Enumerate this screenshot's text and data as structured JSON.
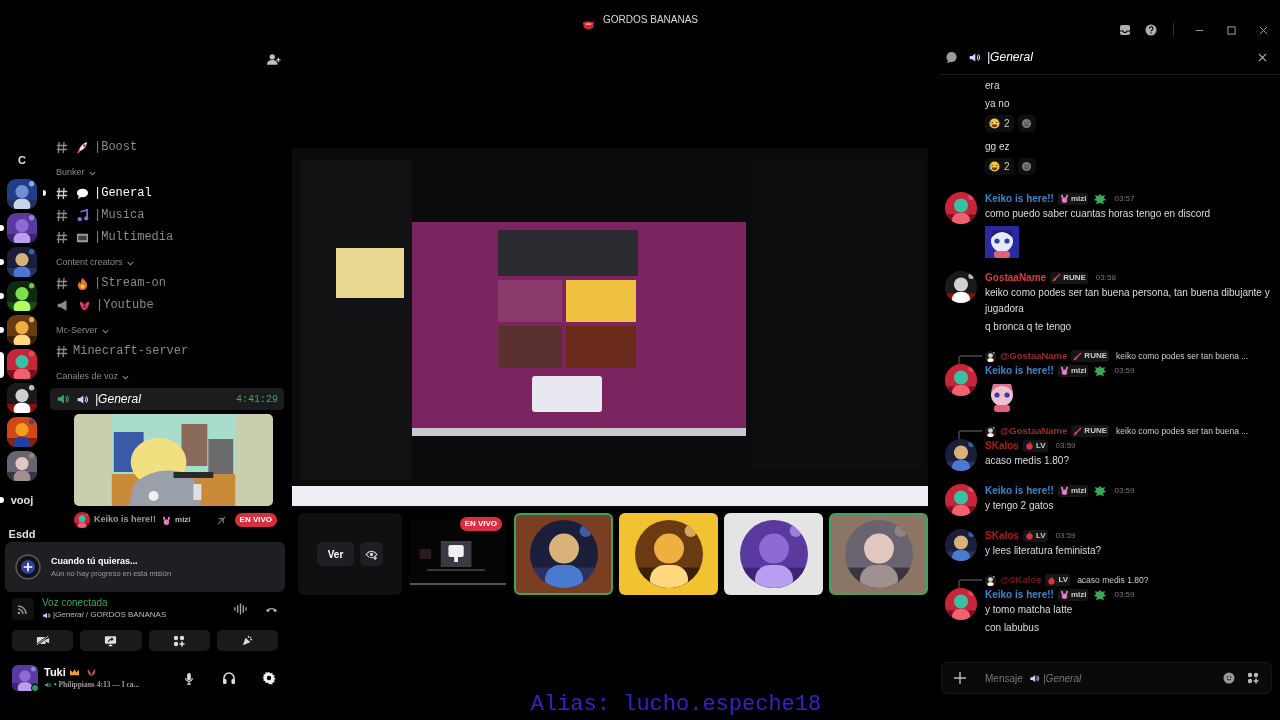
{
  "window": {
    "title": "GORDOS BANANAS"
  },
  "server_rail": [
    {
      "kind": "label",
      "text": "C",
      "unread": false,
      "selected": false
    },
    {
      "kind": "server",
      "unread": false,
      "selected": false
    },
    {
      "kind": "server",
      "unread": true,
      "selected": false
    },
    {
      "kind": "server",
      "unread": true,
      "selected": false
    },
    {
      "kind": "server",
      "unread": true,
      "selected": false
    },
    {
      "kind": "server",
      "unread": true,
      "selected": false
    },
    {
      "kind": "server",
      "unread": false,
      "selected": true
    },
    {
      "kind": "server",
      "unread": false,
      "selected": false
    },
    {
      "kind": "server",
      "unread": false,
      "selected": false
    },
    {
      "kind": "server",
      "unread": false,
      "selected": false
    },
    {
      "kind": "label",
      "text": "vooj",
      "unread": true,
      "selected": false
    },
    {
      "kind": "label",
      "text": "Esdd",
      "unread": false,
      "selected": false
    }
  ],
  "channel_list": {
    "sections": [
      {
        "channels": [
          {
            "kind": "text",
            "name": "|Boost",
            "unread": false,
            "selected": false
          }
        ]
      },
      {
        "title": "Bunker",
        "channels": [
          {
            "kind": "text",
            "name": "|General",
            "unread": true,
            "selected": false
          },
          {
            "kind": "text",
            "name": "|Musica",
            "unread": false,
            "selected": false
          },
          {
            "kind": "text",
            "name": "|Multimedia",
            "unread": false,
            "selected": false
          }
        ]
      },
      {
        "title": "Content creators",
        "channels": [
          {
            "kind": "text",
            "name": "|Stream-on",
            "unread": false,
            "selected": false
          },
          {
            "kind": "announcement",
            "name": "|Youtube",
            "unread": false,
            "selected": false
          }
        ]
      },
      {
        "title": "Mc-Server",
        "channels": [
          {
            "kind": "text",
            "name": "Minecraft-server",
            "unread": false,
            "selected": false
          }
        ]
      },
      {
        "title": "Canales de voz",
        "channels": [
          {
            "kind": "voice",
            "name": "|General",
            "unread": false,
            "selected": true,
            "timer": "4:41:29",
            "members": [
              {
                "name": "Keiko is here!!",
                "tag": "mizi",
                "live": "EN VIVO"
              }
            ]
          }
        ]
      }
    ]
  },
  "mission": {
    "title": "Cuando tú quieras...",
    "subtitle": "Aún no hay progreso en esta misión"
  },
  "voice_status": {
    "label": "Voz conectada",
    "location": "|*General* / GORDOS BANANAS"
  },
  "user_panel": {
    "name": "Tuki",
    "status": "• Philippians 4:13 — I ca..."
  },
  "stage": {
    "view_button": "Ver",
    "tiles": [
      {
        "kind": "stream",
        "live": "EN VIVO",
        "speaking": false
      },
      {
        "kind": "user",
        "speaking": true,
        "color": "#7a3e22"
      },
      {
        "kind": "user",
        "speaking": false,
        "color": "#f2c230"
      },
      {
        "kind": "user",
        "speaking": false,
        "color": "#e4e4e4"
      },
      {
        "kind": "user",
        "speaking": true,
        "color": "#8d7565"
      }
    ]
  },
  "overlay_text": "Alias: lucho.espeche18",
  "chat": {
    "channel": "|General",
    "messages": [
      {
        "kind": "continuation",
        "lines": [
          "era",
          "ya no"
        ],
        "reactions": [
          {
            "count": "2"
          }
        ]
      },
      {
        "kind": "continuation",
        "lines": [
          "gg ez"
        ],
        "reactions": [
          {
            "count": "2"
          }
        ]
      },
      {
        "kind": "message",
        "author": "Keiko is here!!",
        "color": "#3a86c8",
        "tag": "mizi",
        "time": "03:57",
        "lines": [
          "como puedo saber cuantas horas tengo en discord"
        ],
        "sticker": true
      },
      {
        "kind": "message",
        "author": "GostaaName",
        "color": "#d93a3a",
        "tag": "RUNE",
        "time": "03:58",
        "lines": [
          "keiko como podes ser tan buena persona, tan buena dibujante y jugadora",
          "q bronca q te tengo"
        ]
      },
      {
        "kind": "message",
        "reply": {
          "author": "@GostaaName",
          "color": "#9a2c2c",
          "tag": "RUNE",
          "text": "keiko como podes ser tan buena ..."
        },
        "author": "Keiko is here!!",
        "color": "#3a86c8",
        "tag": "mizi",
        "time": "03:59",
        "sticker": true
      },
      {
        "kind": "message",
        "reply": {
          "author": "@GostaaName",
          "color": "#9a2c2c",
          "tag": "RUNE",
          "text": "keiko como podes ser tan buena ..."
        },
        "author": "SKalos",
        "color": "#b3191b",
        "tag": "LV",
        "time": "03:59",
        "lines": [
          "acaso medis 1.80?"
        ]
      },
      {
        "kind": "message",
        "author": "Keiko is here!!",
        "color": "#3a86c8",
        "tag": "mizi",
        "time": "03:59",
        "lines": [
          "y tengo 2 gatos"
        ]
      },
      {
        "kind": "message",
        "author": "SKalos",
        "color": "#b3191b",
        "tag": "LV",
        "time": "03:59",
        "lines": [
          "y lees literatura feminista?"
        ]
      },
      {
        "kind": "message",
        "reply": {
          "author": "@SKalos",
          "color": "#7e1416",
          "tag": "LV",
          "text": "acaso medis 1.80?"
        },
        "author": "Keiko is here!!",
        "color": "#3a86c8",
        "tag": "mizi",
        "time": "03:59",
        "lines": [
          "y tomo matcha latte",
          "con labubus"
        ]
      }
    ],
    "composer": {
      "placeholder": "Mensaje",
      "channel": "|General"
    }
  }
}
